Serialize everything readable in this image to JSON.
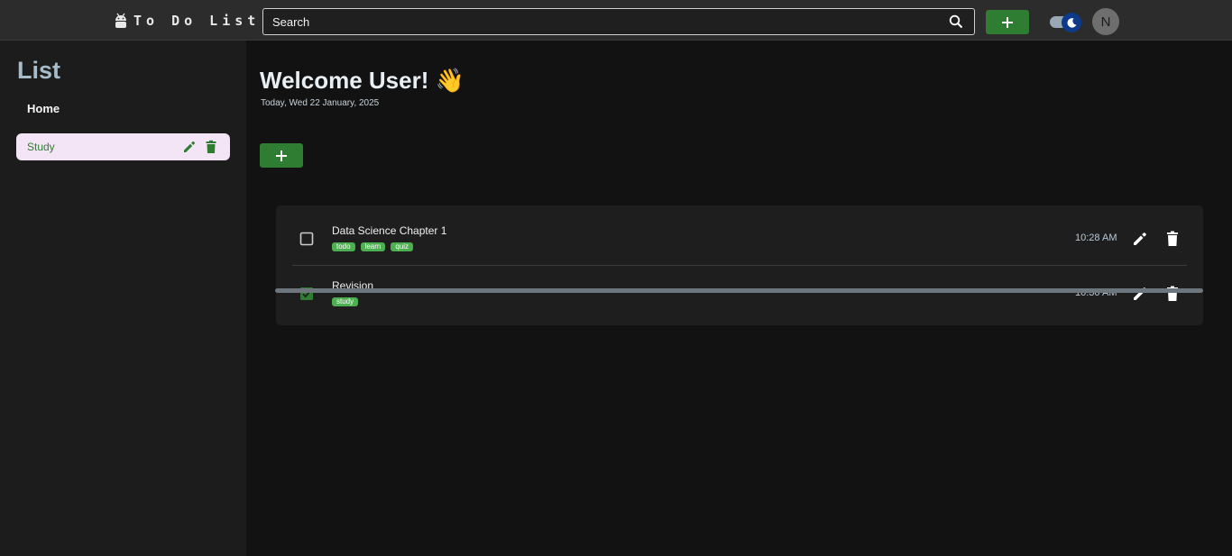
{
  "header": {
    "brand": "To Do List",
    "logo_icon": "android-icon",
    "search_placeholder": "Search",
    "add_label": "+",
    "avatar_initial": "N",
    "theme": "dark"
  },
  "sidebar": {
    "title": "List",
    "home_label": "Home",
    "lists": [
      {
        "label": "Study",
        "active": true
      }
    ]
  },
  "main": {
    "welcome": "Welcome User! 👋",
    "today": "Today, Wed 22 January, 2025",
    "add_label": "+",
    "tasks": [
      {
        "title": "Data Science Chapter 1",
        "tags": [
          "todo",
          "learn",
          "quiz"
        ],
        "time": "10:28 AM",
        "completed": false
      },
      {
        "title": "Revision",
        "tags": [
          "study"
        ],
        "time": "10:30 AM",
        "completed": true
      }
    ]
  },
  "colors": {
    "accent_green": "#2e7d32",
    "tag_green": "#4caf50",
    "active_list_bg": "#f3e5f5",
    "toggle_thumb": "#0d3b8a"
  }
}
